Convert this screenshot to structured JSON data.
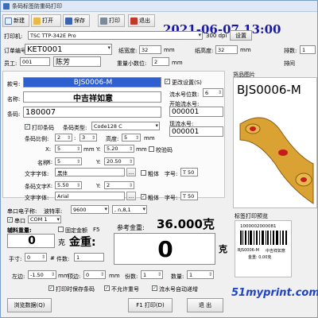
{
  "window": {
    "title": "条码标签防重码打印"
  },
  "toolbar": {
    "new": "新建",
    "open": "打开",
    "save": "保存",
    "print": "打印",
    "exit": "退出"
  },
  "datetime": "2021-06-07 13:00",
  "printer": {
    "label": "打印机:",
    "value": "TSC TTP-342E Pro",
    "dpi": "300 dpi",
    "settings": "设置"
  },
  "row_order": {
    "order_label": "订单编号",
    "order_value": "KET0001",
    "paper_w_label": "纸宽度:",
    "paper_w": "32",
    "mm1": "mm",
    "paper_h_label": "纸高度:",
    "paper_h": "32",
    "mm2": "mm",
    "cols_label": "排数:",
    "cols": "1"
  },
  "row_staff": {
    "staff_label": "员工:",
    "staff_id": "001",
    "staff_name": "陈芳",
    "weight_dec_label": "重量小数位:",
    "weight_dec": "2",
    "mm3": "mm",
    "gap_label": "排间",
    "gap_unit": "mm"
  },
  "form": {
    "fnum_label": "款号:",
    "fnum_value": "BJS0006-M",
    "name_label": "名称:",
    "name_value": "中吉祥如意",
    "barcode_label": "条码:",
    "barcode_value": "180007",
    "print_barcode": "打印条码",
    "type_label": "条码类型:",
    "type_value": "Code128 C",
    "ratio_label": "条码比例:",
    "ratio_a": "2",
    "ratio_b": "3",
    "height_label": "高度:",
    "height": "5",
    "mm": "mm",
    "x_label": "X:",
    "x1": "5",
    "mm_a": "mm",
    "y_label": "Y:",
    "y1": "5.20",
    "mm_b": "mm",
    "verify": "校验码",
    "name2_label": "名称:",
    "nx": "5",
    "ny": "20.50",
    "font_label": "文字字体:",
    "font_value": "黑体",
    "bold_label": "粗体",
    "size_label": "字号:",
    "size1": "T 50",
    "btext_label": "条码文字:",
    "btx": "5.50",
    "bty": "2",
    "btfont_label": "文字字体:",
    "btfont_value": "Arial",
    "size2": "T 50",
    "set_variable": "更改设置(S)",
    "serial_label": "流水号位数:",
    "serial_digits": "6",
    "start_label": "开始流水号:",
    "start_value": "000001",
    "current_label": "现流水号:",
    "current_value": "000001",
    "ellipsis": "..."
  },
  "serial": {
    "port_label": "串口电子称:",
    "baud_label": "波特率:",
    "baud": "9600",
    "format": ", n,8,1",
    "com_check": "串口",
    "com_value": "COM 1"
  },
  "weight": {
    "aux_label": "辅料重量:",
    "aux_value": "0",
    "aux_unit": "克",
    "fix_label": "固定金额",
    "f5": "F5",
    "total_label": "金重:",
    "ref_label": "参考金重:",
    "ref_value": "36.000克",
    "big_value": "0",
    "big_unit": "克",
    "fee_label": "手寸:",
    "fee_value": "0",
    "count_label": "件数:",
    "count_value": "1"
  },
  "margins": {
    "left_label": "左边:",
    "left_value": "-1.50",
    "top_label": "顶边:",
    "top_value": "0",
    "share_label": "份数:",
    "share_value": "1",
    "qty_label": "数量:",
    "qty_value": "1",
    "mm": "mm"
  },
  "options": {
    "opt1": "打印时保存条码",
    "opt2": "不允许重号",
    "opt3": "流水号自动递增"
  },
  "bottom": {
    "browse": "浏览数据(Q)",
    "print": "F1 打印(D)",
    "exit": "退 出"
  },
  "preview": {
    "title": "货品图片",
    "img_text": "BJS0006-M",
    "label_title": "标签打印预览",
    "barcode_text": "1000002000081",
    "small_a": "BJS0006-M",
    "small_b": "中吉祥如意",
    "small_c": "金重: 0.00克"
  },
  "watermark": "51myprint.com",
  "colors": {
    "accent": "#1a1aa6",
    "watermark": "#1e43c8",
    "gold": "#d9a233",
    "ruby": "#c61c1c"
  }
}
